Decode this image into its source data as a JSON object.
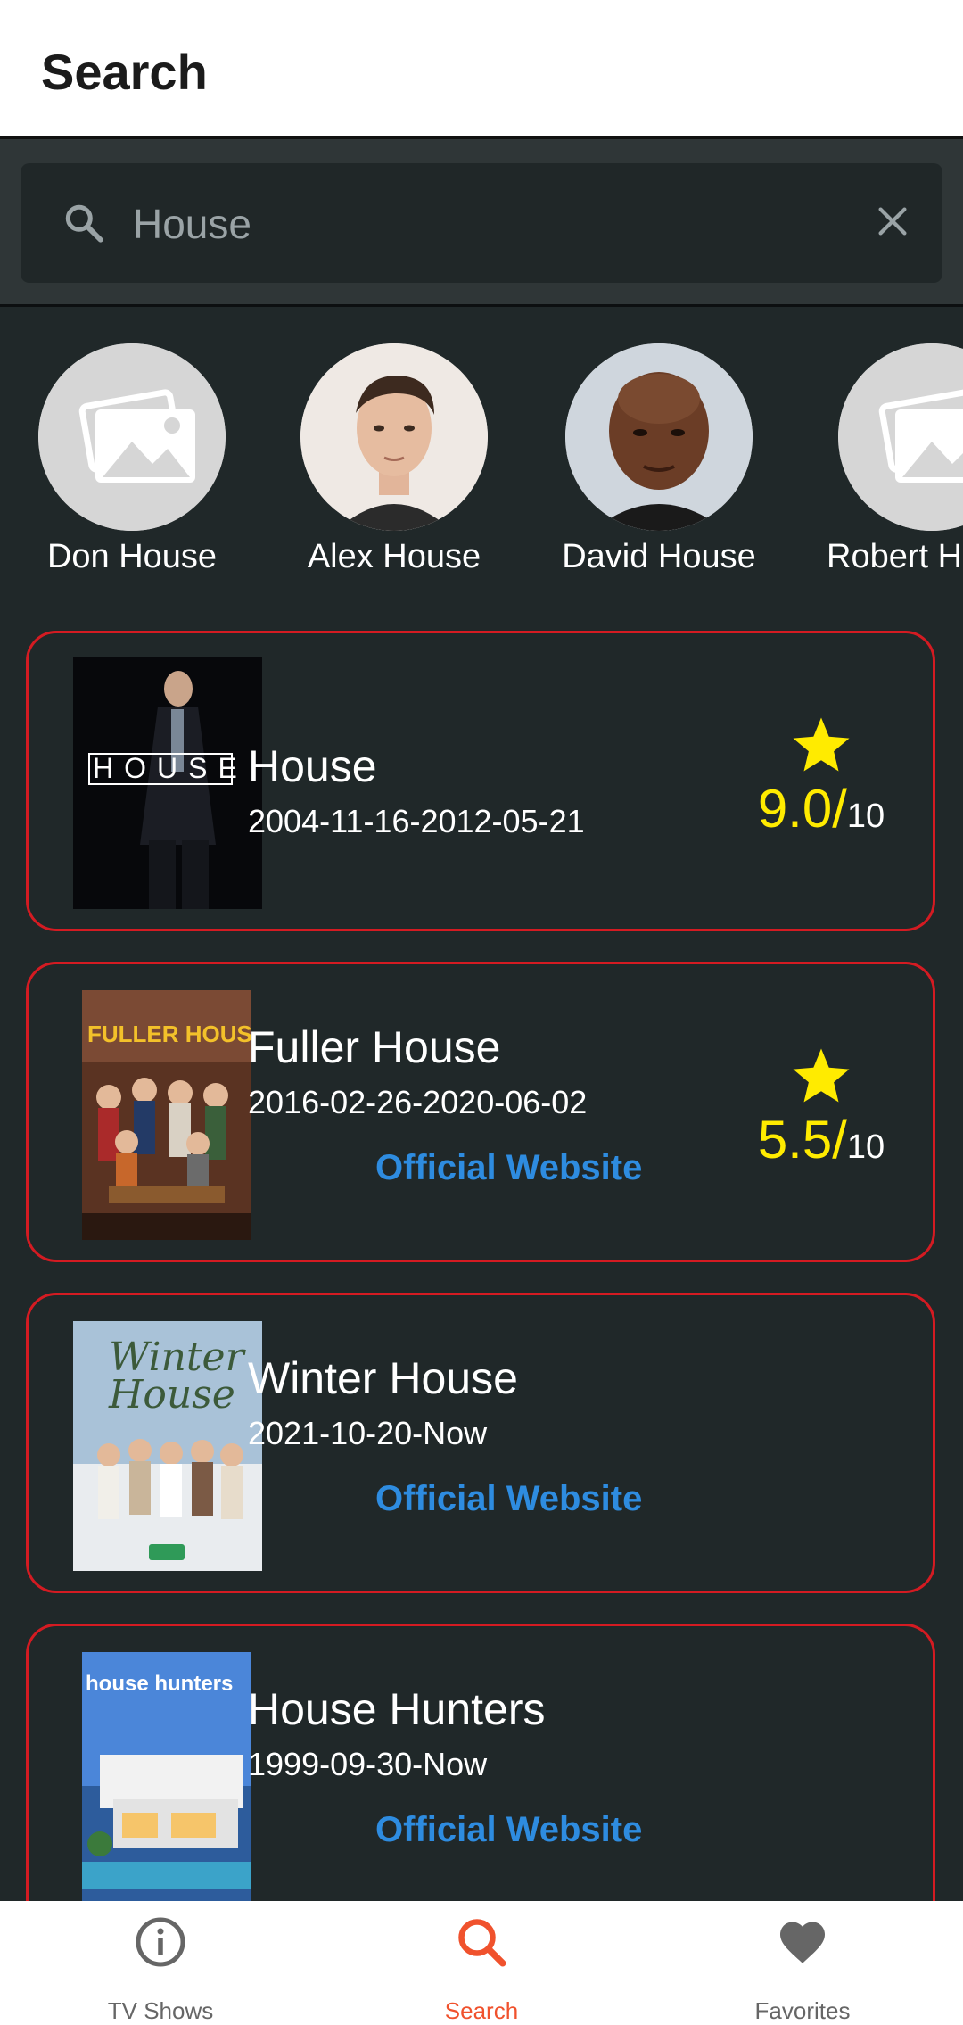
{
  "appbar": {
    "title": "Search"
  },
  "search": {
    "value": "House",
    "placeholder": ""
  },
  "people": [
    {
      "name": "Don House",
      "photo": "placeholder"
    },
    {
      "name": "Alex House",
      "photo": "portrait"
    },
    {
      "name": "David House",
      "photo": "portrait"
    },
    {
      "name": "Robert H",
      "photo": "placeholder"
    }
  ],
  "results": [
    {
      "title": "House",
      "dates": "2004-11-16-2012-05-21",
      "link": "",
      "rating": "9.0/",
      "rating_max": "10",
      "poster_text": "HOUSE"
    },
    {
      "title": "Fuller House",
      "dates": "2016-02-26-2020-06-02",
      "link": "Official Website",
      "rating": "5.5/",
      "rating_max": "10",
      "poster_text": "FULLER HOUSE"
    },
    {
      "title": "Winter House",
      "dates": "2021-10-20-Now",
      "link": "Official Website",
      "rating": "",
      "rating_max": "",
      "poster_text": "Winter House"
    },
    {
      "title": "House Hunters",
      "dates": "1999-09-30-Now",
      "link": "Official Website",
      "rating": "",
      "rating_max": "",
      "poster_text": "house hunters"
    }
  ],
  "nav": [
    {
      "label": "TV Shows",
      "icon": "info-icon"
    },
    {
      "label": "Search",
      "icon": "search-icon",
      "active": true
    },
    {
      "label": "Favorites",
      "icon": "heart-icon"
    }
  ],
  "colors": {
    "accent": "#f0522d",
    "link": "#2e8ce0",
    "card_border": "#d41b22",
    "rating": "#ffeb00",
    "background": "#202829"
  }
}
